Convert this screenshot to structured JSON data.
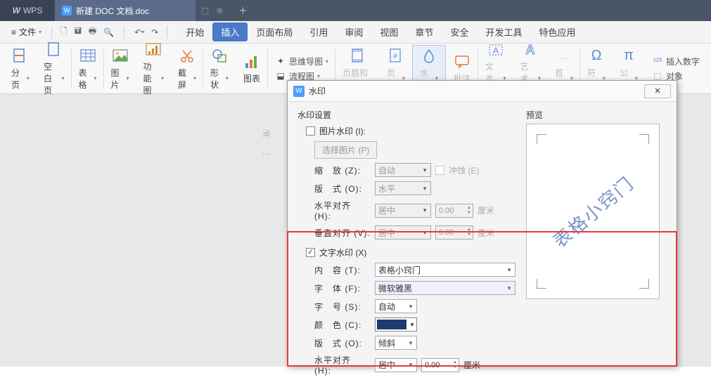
{
  "app": {
    "name": "WPS"
  },
  "doc_tab": {
    "title": "新建 DOC 文档.doc"
  },
  "menu": {
    "file": "文件",
    "tabs": [
      "开始",
      "插入",
      "页面布局",
      "引用",
      "审阅",
      "视图",
      "章节",
      "安全",
      "开发工具",
      "特色应用"
    ],
    "active_index": 1
  },
  "ribbon": {
    "page_break": "分页",
    "blank_page": "空白页",
    "table": "表格",
    "picture": "图片",
    "feature_pic": "功能图",
    "screenshot": "截屏",
    "shape": "形状",
    "chart": "图表",
    "mindmap": "思维导图",
    "flowchart": "流程图",
    "header_footer": "页眉和页脚",
    "page_number": "页码",
    "watermark": "水印",
    "comment": "批注",
    "textbox": "文本框",
    "wordart": "艺术字",
    "dropcap": "首字",
    "symbol": "符号",
    "equation": "公式",
    "number": "插入数字",
    "object": "对象"
  },
  "dialog": {
    "title": "水印",
    "section": "水印设置",
    "pic_watermark": "图片水印 (I):",
    "select_pic": "选择图片 (P)",
    "zoom": "缩　放 (Z):",
    "zoom_val": "自动",
    "washout": "冲蚀 (E)",
    "layout": "版　式 (O):",
    "layout_val": "水平",
    "halign": "水平对齐 (H):",
    "halign_val": "居中",
    "valign": "垂直对齐 (V):",
    "valign_val": "居中",
    "num_zero": "0.00",
    "unit_cm": "厘米",
    "text_watermark": "文字水印 (X)",
    "content": "内　容 (T):",
    "content_val": "表格小窍门",
    "font": "字　体 (F):",
    "font_val": "微软雅黑",
    "fontsize": "字　号 (S):",
    "fontsize_val": "自动",
    "color": "颜　色 (C):",
    "layout2": "版　式 (O):",
    "layout2_val": "倾斜",
    "halign2": "水平对齐 (H):",
    "halign2_val": "居中",
    "preview": "预览",
    "preview_text": "表格小窍门"
  }
}
